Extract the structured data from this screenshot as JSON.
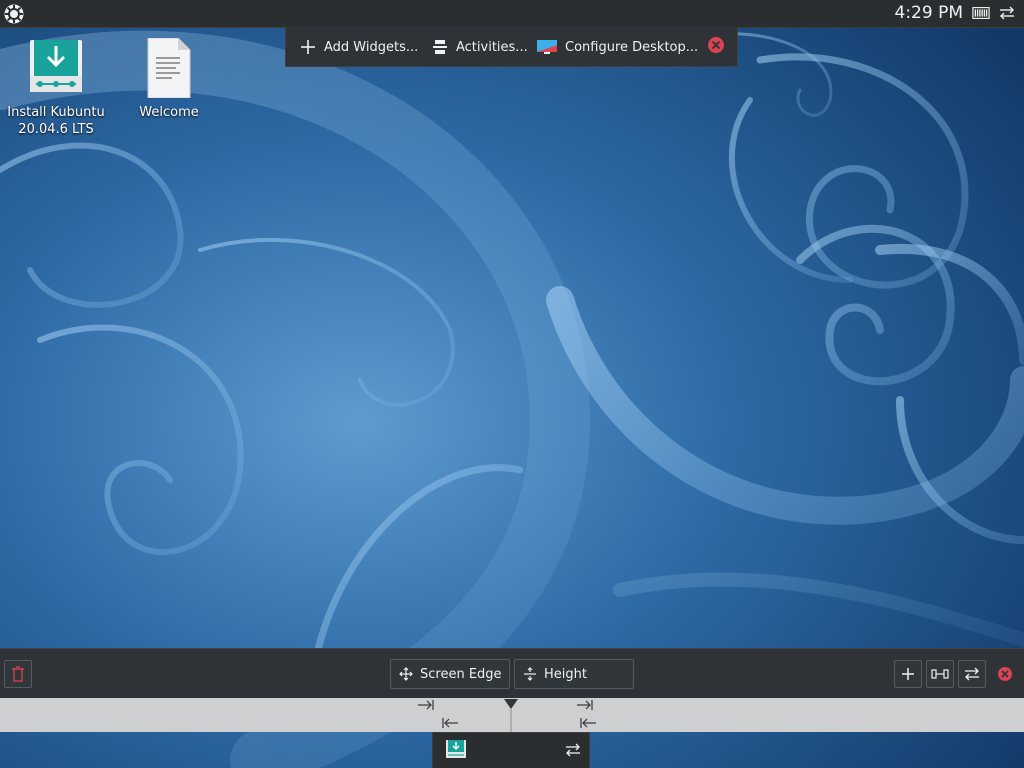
{
  "top_panel": {
    "clock": "4:29 PM",
    "icons": [
      "application-launcher-icon",
      "battery-icon",
      "panel-settings-icon"
    ]
  },
  "toolbox": {
    "add_widgets": "Add Widgets...",
    "activities": "Activities...",
    "configure_desktop": "Configure Desktop..."
  },
  "desktop": {
    "icons": [
      {
        "line1": "Install Kubuntu",
        "line2": "20.04.6 LTS",
        "icon": "installer-icon"
      },
      {
        "line1": "Welcome",
        "icon": "document-icon"
      }
    ]
  },
  "panel_editor": {
    "screen_edge": "Screen Edge",
    "height": "Height"
  },
  "colors": {
    "panel_bg": "#2b2e31",
    "accent_teal": "#1aa39a",
    "close_red": "#da4453",
    "ruler_bg": "#cdcfd1"
  }
}
